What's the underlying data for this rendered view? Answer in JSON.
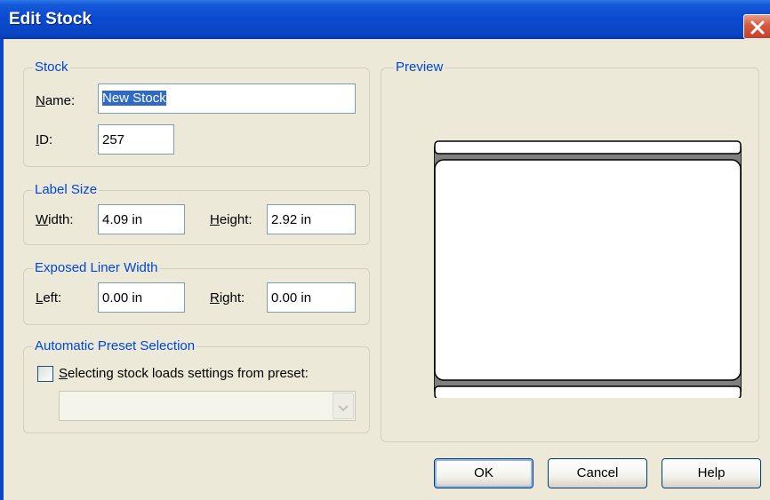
{
  "window": {
    "title": "Edit Stock"
  },
  "stock": {
    "legend": "Stock",
    "name_label_mnemonic": "N",
    "name_label_rest": "ame:",
    "name_value": "New Stock",
    "id_label_mnemonic": "I",
    "id_label_rest": "D:",
    "id_value": "257"
  },
  "label_size": {
    "legend": "Label Size",
    "width_label_mnemonic": "W",
    "width_label_rest": "idth:",
    "width_value": "4.09 in",
    "height_label_mnemonic": "H",
    "height_label_rest": "eight:",
    "height_value": "2.92 in"
  },
  "liner": {
    "legend": "Exposed Liner Width",
    "left_label_mnemonic": "L",
    "left_label_rest": "eft:",
    "left_value": "0.00 in",
    "right_label_mnemonic": "R",
    "right_label_rest": "ight:",
    "right_value": "0.00 in"
  },
  "preset": {
    "legend": "Automatic Preset Selection",
    "checkbox_label_mnemonic": "S",
    "checkbox_label_rest": "electing stock loads settings from preset:",
    "checked": false,
    "selected_value": ""
  },
  "preview": {
    "legend": "Preview"
  },
  "buttons": {
    "ok": "OK",
    "cancel": "Cancel",
    "help": "Help"
  },
  "icons": {
    "close": "close-icon",
    "dropdown": "chevron-down-icon"
  }
}
